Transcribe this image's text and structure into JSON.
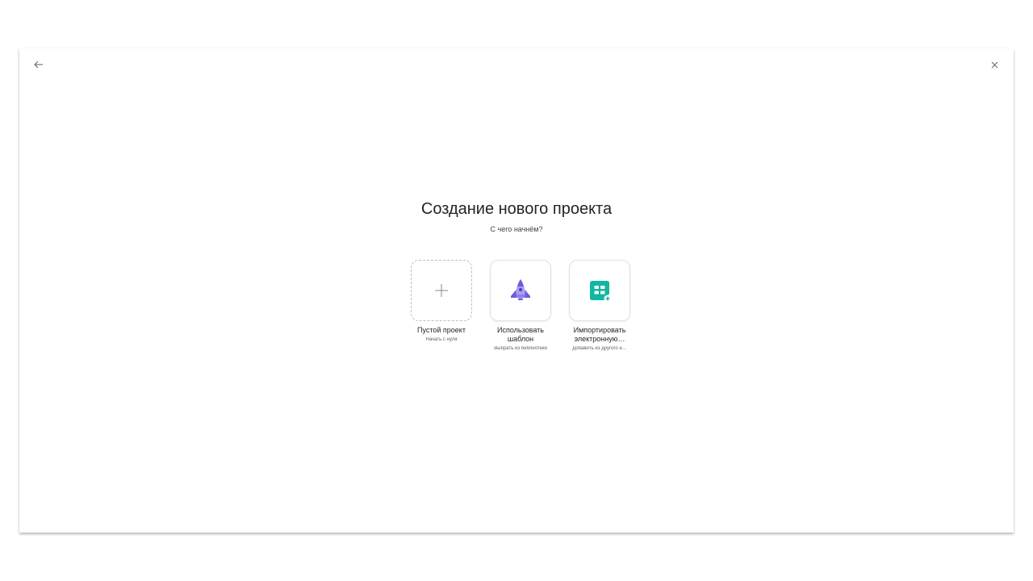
{
  "header": {
    "back_glyph": "←",
    "close_glyph": "×"
  },
  "title": "Создание нового проекта",
  "subtitle": "С чего начнём?",
  "options": [
    {
      "label": "Пустой проект",
      "description": "Начать с нуля",
      "icon": "plus-icon"
    },
    {
      "label": "Использовать шаблон",
      "description": "Выбрать из библиотеки",
      "icon": "rocket-icon"
    },
    {
      "label": "Импортировать электронную…",
      "description": "Добавить из другого и…",
      "icon": "spreadsheet-add-icon"
    }
  ],
  "colors": {
    "rocket": "#7b6ce0",
    "spreadsheet": "#13b6a0"
  }
}
